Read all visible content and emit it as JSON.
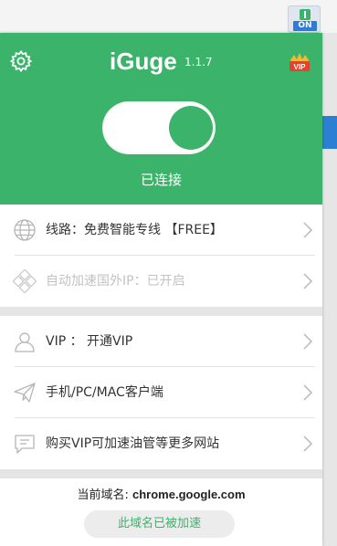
{
  "browser": {
    "extension_badge": "ON"
  },
  "header": {
    "title": "iGuge",
    "version": "1.1.7",
    "vip_badge": "VIP",
    "status": "已连接",
    "toggle_on": true,
    "icons": {
      "settings": "gear-icon",
      "vip": "vip-crown-icon"
    }
  },
  "menu": {
    "route": {
      "label": "线路：免费智能专线 【FREE】",
      "icon": "globe-icon"
    },
    "auto_accel": {
      "label": "自动加速国外IP：已开启",
      "icon": "network-icon"
    },
    "vip": {
      "label": "VIP ： 开通VIP",
      "icon": "user-icon"
    },
    "clients": {
      "label": "手机/PC/MAC客户端",
      "icon": "paper-plane-icon"
    },
    "more_sites": {
      "label": "购买VIP可加速油管等更多网站",
      "icon": "chat-bubble-icon"
    }
  },
  "footer": {
    "domain_label": "当前域名:",
    "domain_value": "chrome.google.com",
    "accel_status": "此域名已被加速"
  },
  "colors": {
    "brand_green": "#3cb36a",
    "text_dark": "#333333",
    "text_disabled": "#c2c2c2"
  }
}
